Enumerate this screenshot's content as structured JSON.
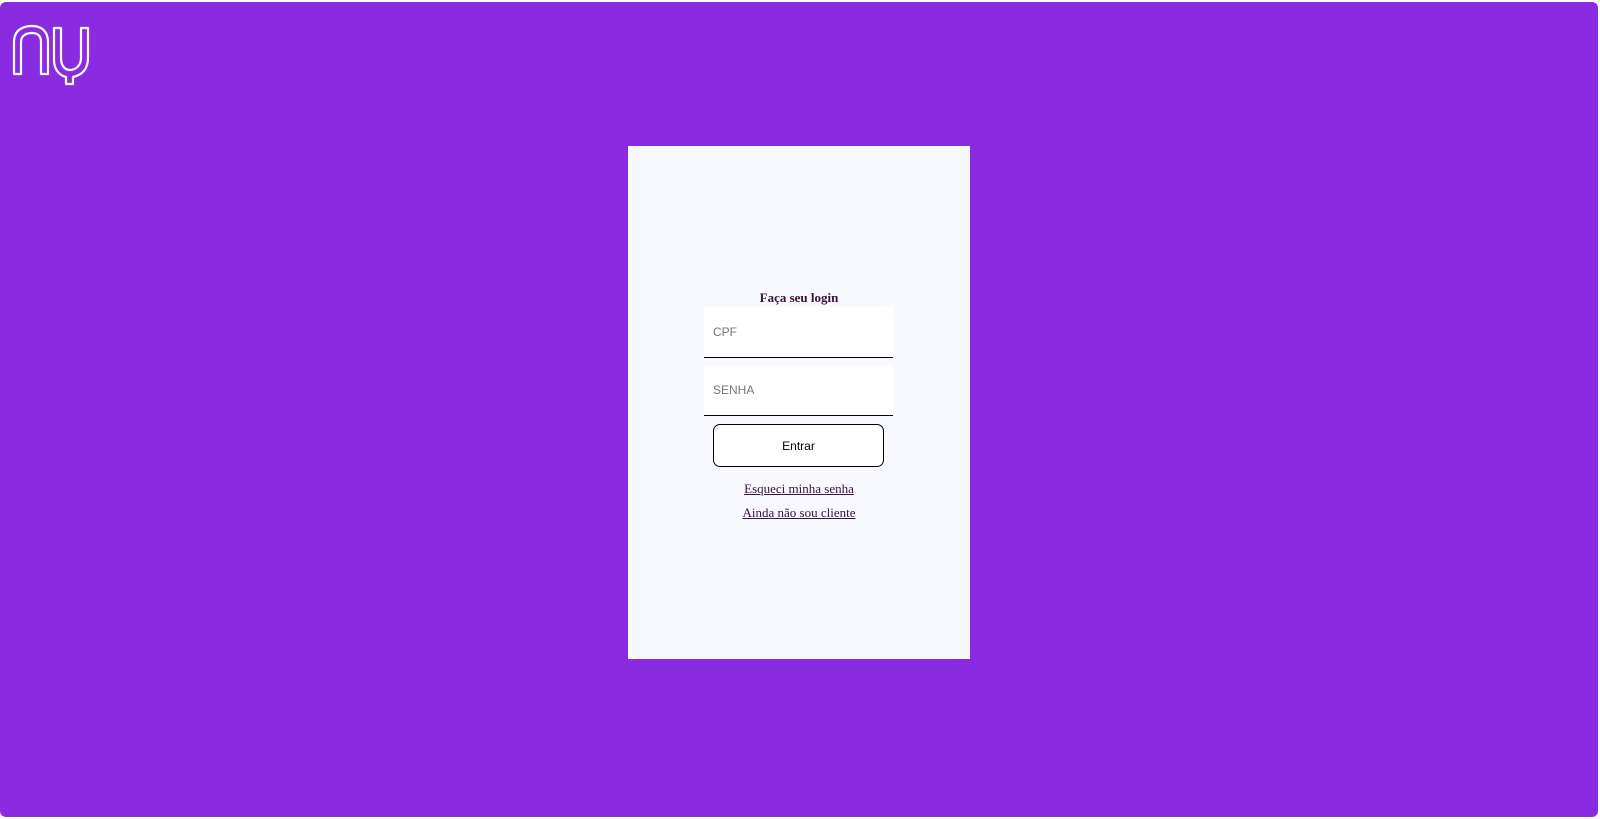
{
  "header": {
    "logo_icon": "nubank-nu-logo-icon"
  },
  "login": {
    "title": "Faça seu login",
    "cpf_placeholder": "CPF",
    "cpf_value": "",
    "password_placeholder": "SENHA",
    "password_value": "",
    "submit_label": "Entrar",
    "forgot_password_link": "Esqueci minha senha",
    "not_client_link": "Ainda não sou cliente"
  },
  "colors": {
    "background": "#8a2be2",
    "card": "#f8f8ff",
    "text": "#3a1140"
  }
}
